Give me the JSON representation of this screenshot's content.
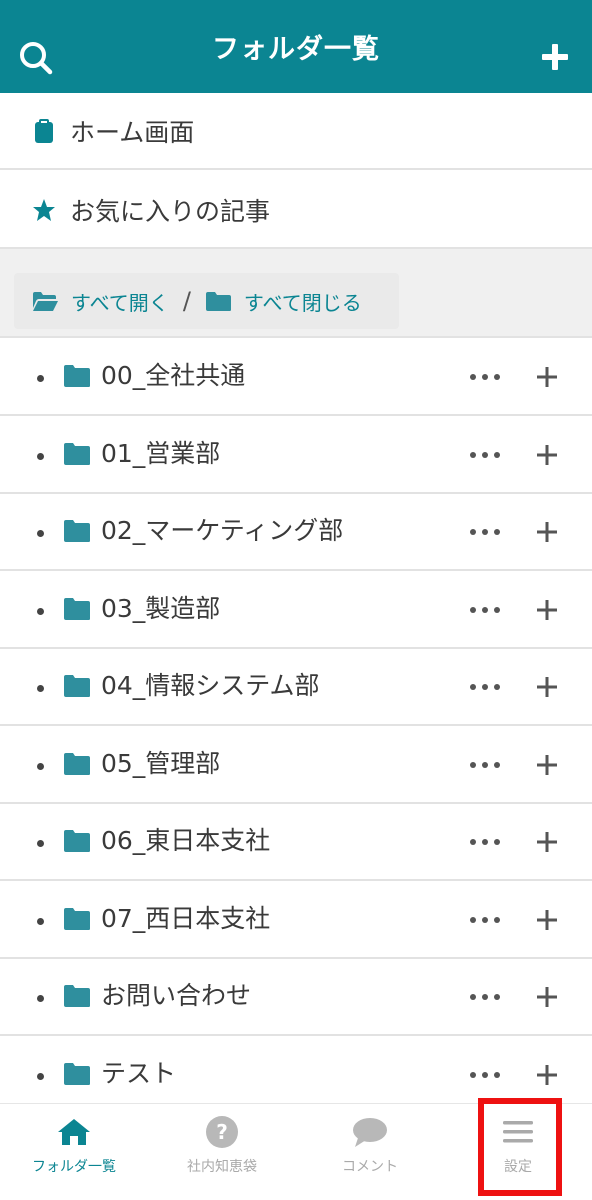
{
  "header": {
    "title": "フォルダ一覧",
    "search_icon": "search-icon",
    "add_icon": "plus-icon",
    "background": "#0b8592"
  },
  "nav": {
    "home": {
      "label": "ホーム画面",
      "icon": "clipboard-icon"
    },
    "favorites": {
      "label": "お気に入りの記事",
      "icon": "star-icon"
    }
  },
  "folder_toggle": {
    "open_all": "すべて開く",
    "separator": "/",
    "close_all": "すべて閉じる"
  },
  "folders": [
    {
      "label": "00_全社共通"
    },
    {
      "label": "01_営業部"
    },
    {
      "label": "02_マーケティング部"
    },
    {
      "label": "03_製造部"
    },
    {
      "label": "04_情報システム部"
    },
    {
      "label": "05_管理部"
    },
    {
      "label": "06_東日本支社"
    },
    {
      "label": "07_西日本支社"
    },
    {
      "label": "お問い合わせ"
    },
    {
      "label": "テスト"
    }
  ],
  "tabbar": {
    "tabs": [
      {
        "label": "フォルダ一覧",
        "icon": "home-icon",
        "active": true
      },
      {
        "label": "社内知恵袋",
        "icon": "question-icon",
        "active": false
      },
      {
        "label": "コメント",
        "icon": "chat-bubble-icon",
        "active": false
      },
      {
        "label": "設定",
        "icon": "menu-icon",
        "active": false
      }
    ]
  },
  "colors": {
    "accent": "#0b8592",
    "folder": "#2f8f9e",
    "highlight": "#ee1111"
  }
}
